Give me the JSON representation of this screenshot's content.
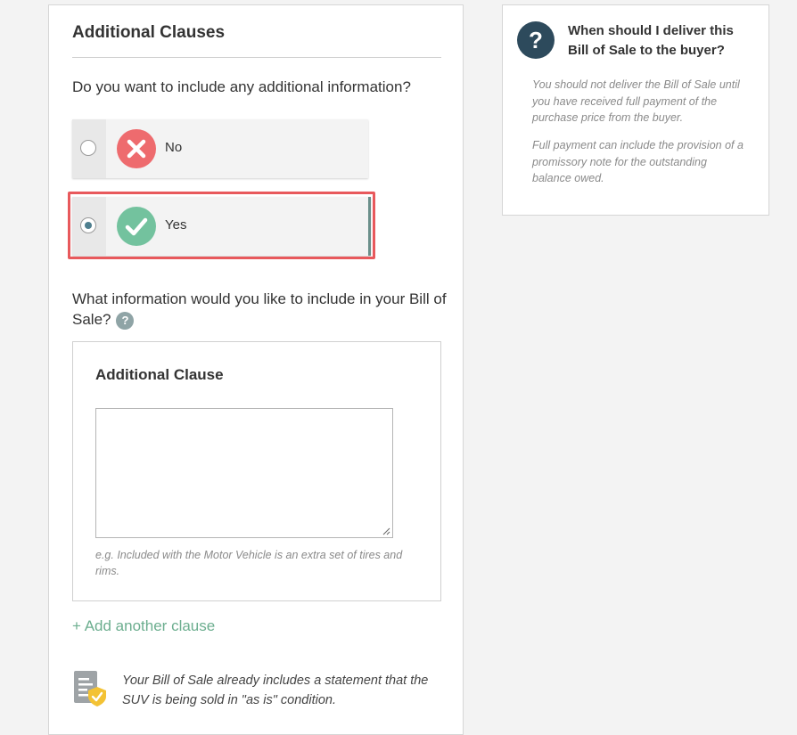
{
  "section": {
    "title": "Additional Clauses",
    "question": "Do you want to include any additional information?"
  },
  "options": [
    {
      "label": "No",
      "selected": false,
      "icon": "x-circle-icon",
      "color": "#ee6b6e"
    },
    {
      "label": "Yes",
      "selected": true,
      "icon": "check-circle-icon",
      "color": "#73c29e"
    }
  ],
  "clauses": {
    "question": "What information would you like to include in your Bill of Sale?",
    "help_icon": "?",
    "box_title": "Additional Clause",
    "textarea_value": "",
    "hint": "e.g. Included with the Motor Vehicle is an extra set of tires and rims.",
    "add_label": "+ Add another clause"
  },
  "note": {
    "icon": "document-shield-icon",
    "text": "Your Bill of Sale already includes a statement that the SUV is being sold in \"as is\" condition."
  },
  "sidebar": {
    "icon": "?",
    "title": "When should I deliver this Bill of Sale to the buyer?",
    "paragraphs": [
      "You should not deliver the Bill of Sale until you have received full payment of the purchase price from the buyer.",
      "Full payment can include the provision of a promissory note for the outstanding balance owed."
    ]
  },
  "colors": {
    "accent_green": "#6cae8f",
    "highlight_red": "#e8595c",
    "navy": "#2d4a5c"
  }
}
